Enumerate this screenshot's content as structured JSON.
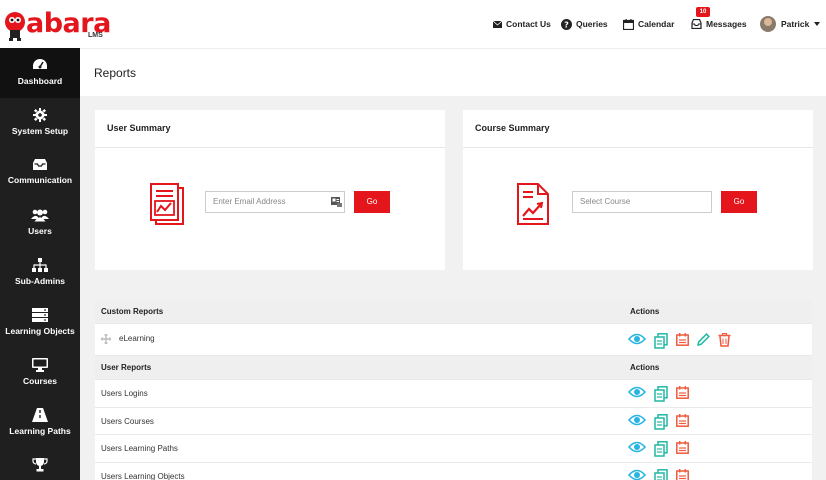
{
  "brand": {
    "name": "abara",
    "sub": "LMS",
    "color": "#e4161b"
  },
  "topnav": {
    "contact": "Contact Us",
    "queries": "Queries",
    "calendar": "Calendar",
    "messages": "Messages",
    "messages_badge": "10",
    "user": "Patrick"
  },
  "sidebar": {
    "items": [
      {
        "label": "Dashboard",
        "icon": "dashboard-icon"
      },
      {
        "label": "System Setup",
        "icon": "gear-icon"
      },
      {
        "label": "Communication",
        "icon": "inbox-icon"
      },
      {
        "label": "Users",
        "icon": "users-icon"
      },
      {
        "label": "Sub-Admins",
        "icon": "sitemap-icon"
      },
      {
        "label": "Learning Objects",
        "icon": "server-icon"
      },
      {
        "label": "Courses",
        "icon": "monitor-icon"
      },
      {
        "label": "Learning Paths",
        "icon": "road-icon"
      },
      {
        "label": "",
        "icon": "trophy-icon"
      }
    ]
  },
  "page": {
    "title": "Reports"
  },
  "user_summary": {
    "title": "User Summary",
    "placeholder": "Enter Email Address",
    "button": "Go"
  },
  "course_summary": {
    "title": "Course Summary",
    "placeholder": "Select Course",
    "button": "Go"
  },
  "custom_reports": {
    "header": "Custom Reports",
    "actions_header": "Actions",
    "rows": [
      {
        "name": "eLearning"
      }
    ]
  },
  "user_reports": {
    "header": "User Reports",
    "actions_header": "Actions",
    "rows": [
      {
        "name": "Users Logins"
      },
      {
        "name": "Users Courses"
      },
      {
        "name": "Users Learning Paths"
      },
      {
        "name": "Users Learning Objects"
      }
    ]
  },
  "colors": {
    "view": "#27b6e3",
    "copy": "#20b8a4",
    "schedule": "#f05a3c",
    "edit": "#20b8a4",
    "delete": "#f05a3c"
  }
}
